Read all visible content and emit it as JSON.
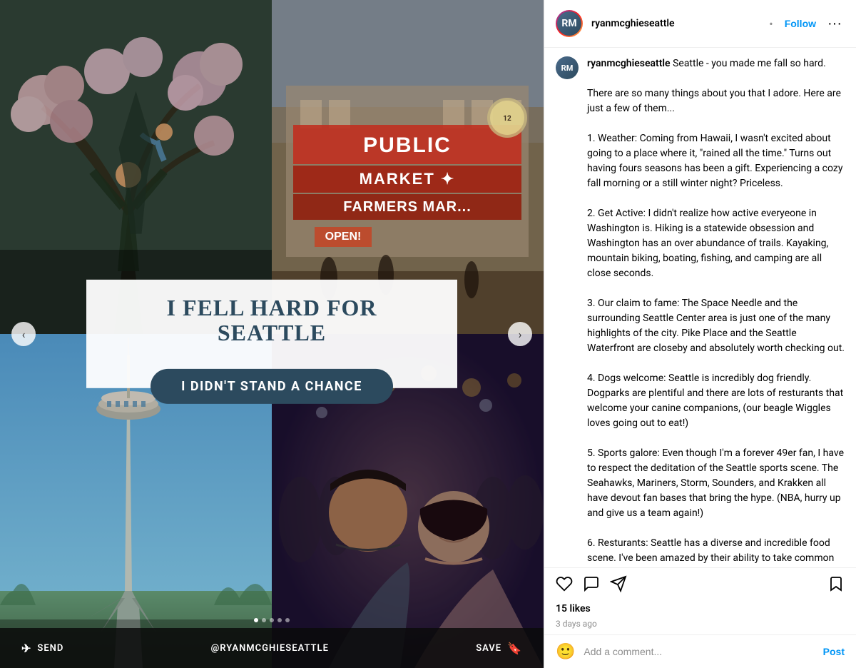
{
  "header": {
    "username": "ryanmcghieseattle",
    "follow_label": "Follow",
    "separator": "•",
    "more_icon": "ellipsis",
    "avatar_initials": "RM"
  },
  "post": {
    "overlay_title": "I FELL HARD FOR SEATTLE",
    "overlay_subtitle": "I DIDN'T STAND A CHANCE",
    "nav_next": "›",
    "nav_prev": "‹"
  },
  "bottom_bar": {
    "send_label": "SEND",
    "username_label": "@RYANMCGHIESEATTLE",
    "save_label": "SAVE",
    "send_icon": "send-icon",
    "save_icon": "bookmark-icon"
  },
  "dots": [
    {
      "active": true
    },
    {
      "active": false
    },
    {
      "active": false
    },
    {
      "active": false
    },
    {
      "active": false
    }
  ],
  "comment": {
    "username": "ryanmcghieseattle",
    "caption_bold": "Seattle - you made me fall so hard.",
    "caption_text": "\n\nThere are so many things about you that I adore. Here are just a few of them...\n\n1. Weather: Coming from Hawaii, I wasn't excited about going to a place where it, \"rained all the time.\" Turns out having fours seasons has been a gift. Experiencing a cozy fall morning or a still winter night? Priceless.\n\n2. Get Active: I didn't realize how active everyeone in Washington is. Hiking is a statewide obsession and Washington has an over abundance of trails. Kayaking, mountain biking, boating, fishing, and camping are all close seconds.\n\n3. Our claim to fame: The Space Needle and the surrounding Seattle Center area is just one of the many highlights of the city. Pike Place and the Seattle Waterfront are closeby and absolutely worth checking out.\n\n4. Dogs welcome: Seattle is incredibly dog friendly. Dogparks are plentiful and there are lots of resturants that welcome your canine companions, (our beagle Wiggles loves going out to eat!)\n\n5. Sports galore: Even though I'm a forever 49er fan, I have to respect the deditation of the Seattle sports scene. The Seahawks, Mariners, Storm, Sounders, and Krakken all have devout fan bases that bring the hype. (NBA, hurry up and give us a team again!)\n\n6. Resturants: Seattle has a diverse and incredible food scene. I've been amazed by their ability to take common comfort foods and elevate them to something magical. (Shout out to @tomdouglasco and all his insanely good resturants.)\n\nGrab my local's guide to Seattle for some of my favorite spots!",
    "time": "3d"
  },
  "actions": {
    "like_icon": "heart-icon",
    "comment_icon": "comment-icon",
    "share_icon": "share-icon",
    "bookmark_icon": "bookmark-icon"
  },
  "likes": {
    "count": "15 likes",
    "time": "3 days ago"
  },
  "add_comment": {
    "emoji_icon": "emoji-icon",
    "placeholder": "Add a comment...",
    "post_label": "Post"
  },
  "images": {
    "top_left_alt": "Father tossing child with cherry blossoms",
    "top_right_alt": "Public Market Center sign in Seattle",
    "bottom_left_alt": "Space Needle against blue sky",
    "bottom_right_alt": "Couple selfie at Seattle venue"
  }
}
